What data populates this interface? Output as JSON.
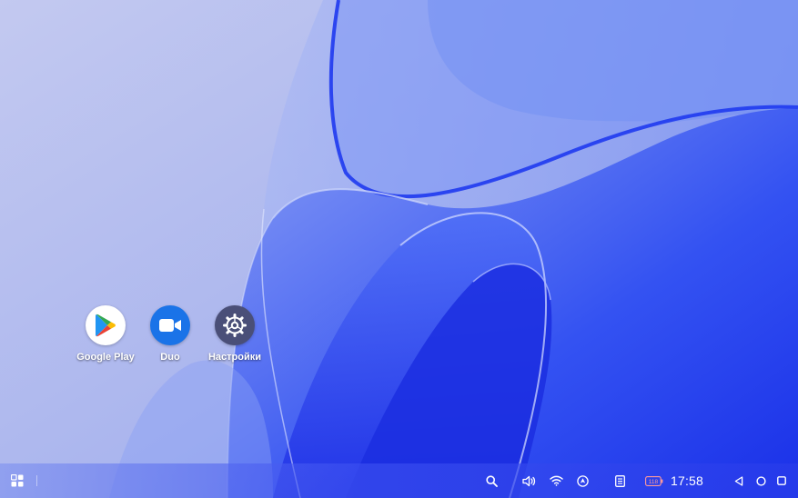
{
  "desktop": {
    "apps": [
      {
        "label": "Google Play",
        "icon": "google-play-icon"
      },
      {
        "label": "Duo",
        "icon": "duo-video-icon"
      },
      {
        "label": "Настройки",
        "icon": "settings-gear-icon"
      }
    ]
  },
  "taskbar": {
    "launcher_icon": "app-grid-icon",
    "tray_icons": [
      "search-icon",
      "volume-icon",
      "wifi-icon",
      "location-up-icon",
      "notes-icon",
      "battery-icon"
    ],
    "battery_level": "118",
    "clock": "17:58",
    "nav_icons": [
      "back-icon",
      "home-icon",
      "recents-icon"
    ]
  },
  "colors": {
    "wallpaper_bg": "#b4bdec",
    "wave_blue": "#1f3cf0",
    "duo_blue": "#1a73e8",
    "settings_bg": "#4a4f78",
    "text_white": "#ffffff"
  }
}
